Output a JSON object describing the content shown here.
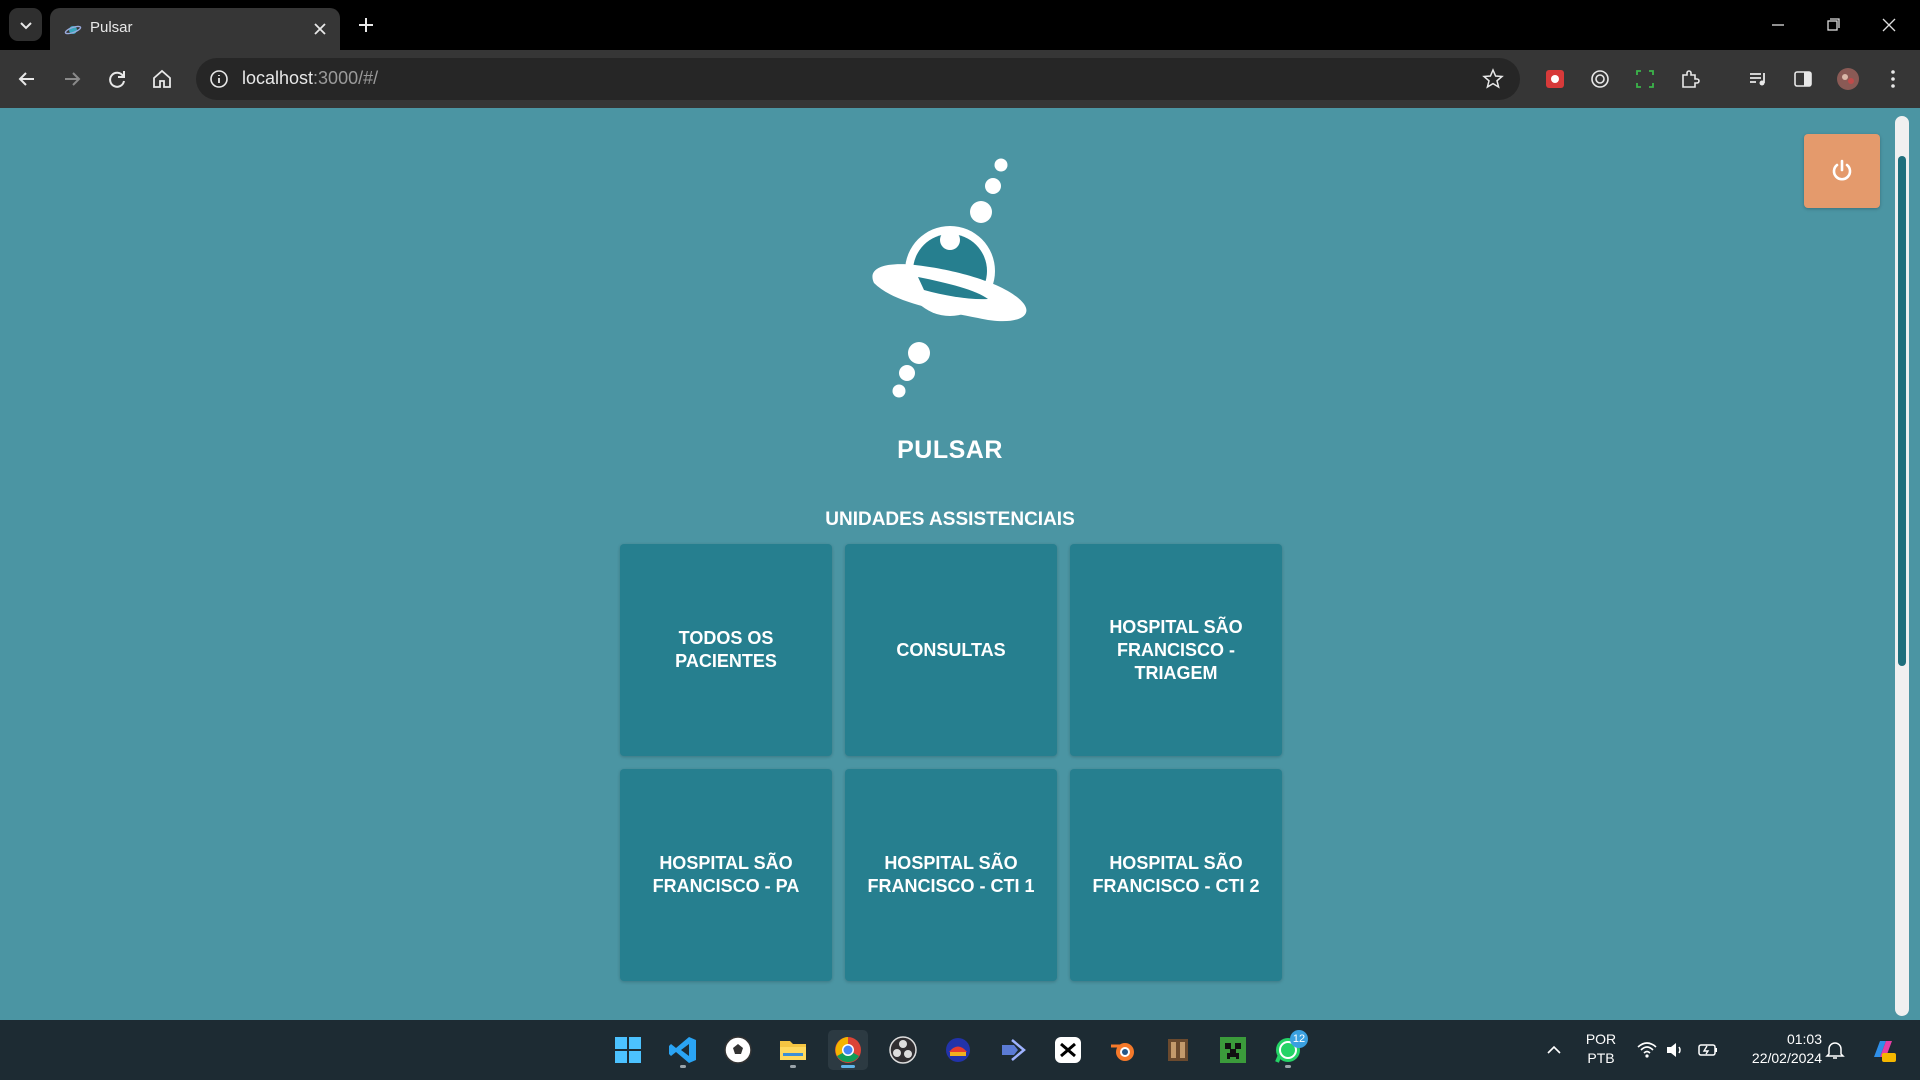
{
  "browser": {
    "tab_title": "Pulsar",
    "url_host": "localhost",
    "url_rest": ":3000/#/"
  },
  "page": {
    "app_title": "PULSAR",
    "section_title": "UNIDADES ASSISTENCIAIS",
    "units": [
      {
        "label": "TODOS OS PACIENTES"
      },
      {
        "label": "CONSULTAS"
      },
      {
        "label": "HOSPITAL SÃO FRANCISCO - TRIAGEM"
      },
      {
        "label": "HOSPITAL SÃO FRANCISCO - PA"
      },
      {
        "label": "HOSPITAL SÃO FRANCISCO - CTI 1"
      },
      {
        "label": "HOSPITAL SÃO FRANCISCO - CTI 2"
      }
    ],
    "colors": {
      "background": "#4b95a3",
      "card": "#267f8f",
      "power_button": "#e49a6c"
    }
  },
  "taskbar": {
    "apps": [
      "start-icon",
      "vscode-icon",
      "soccer-app-icon",
      "file-explorer-icon",
      "chrome-icon",
      "obs-icon",
      "app-icon",
      "devtool-icon",
      "capcut-icon",
      "blender-icon",
      "game-icon",
      "minecraft-icon",
      "whatsapp-icon"
    ],
    "whatsapp_badge": "12",
    "language": "POR",
    "keyboard": "PTB",
    "time": "01:03",
    "date": "22/02/2024"
  }
}
